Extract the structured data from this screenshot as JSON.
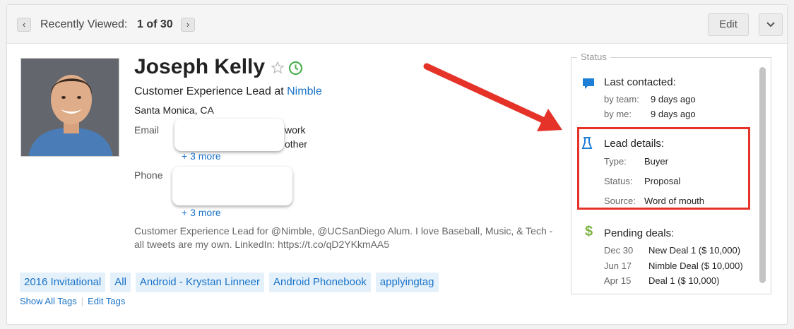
{
  "nav": {
    "prev_icon": "‹",
    "next_icon": "›",
    "label": "Recently Viewed:",
    "count": "1 of 30"
  },
  "actions": {
    "edit_label": "Edit",
    "dropdown_icon": "chevron-down-icon"
  },
  "contact": {
    "name": "Joseph Kelly",
    "title_prefix": "Customer Experience Lead at ",
    "company": "Nimble",
    "location": "Santa Monica, CA",
    "email_label": "Email",
    "email_types": [
      "work",
      "other"
    ],
    "email_more": "+ 3 more",
    "phone_label": "Phone",
    "phone_more": "+ 3 more",
    "bio": "Customer Experience Lead for @Nimble, @UCSanDiego Alum. I love Baseball, Music, & Tech - all tweets are my own. LinkedIn: https://t.co/qD2YKkmAA5"
  },
  "tags": [
    "2016 Invitational",
    "All",
    "Android - Krystan Linneer",
    "Android Phonebook",
    "applyingtag"
  ],
  "tag_links": {
    "show_all": "Show All Tags",
    "edit": "Edit Tags"
  },
  "status": {
    "legend": "Status",
    "last_contacted": {
      "title": "Last contacted:",
      "team_label": "by team:",
      "team_value": "9 days ago",
      "me_label": "by me:",
      "me_value": "9 days ago"
    },
    "lead": {
      "title": "Lead details:",
      "type_label": "Type:",
      "type_value": "Buyer",
      "status_label": "Status:",
      "status_value": "Proposal",
      "source_label": "Source:",
      "source_value": "Word of mouth"
    },
    "deals": {
      "title": "Pending deals:",
      "items": [
        {
          "date": "Dec 30",
          "name": "New Deal 1 ($ 10,000)"
        },
        {
          "date": "Jun 17",
          "name": "Nimble Deal ($ 10,000)"
        },
        {
          "date": "Apr 15",
          "name": "Deal 1 ($ 10,000)"
        }
      ]
    }
  },
  "colors": {
    "accent": "#1a73c7",
    "highlight": "#e5332a",
    "star": "#bbbbbb",
    "clock": "#4caf50",
    "chat": "#1e7fd6",
    "dollar": "#7cb342"
  }
}
